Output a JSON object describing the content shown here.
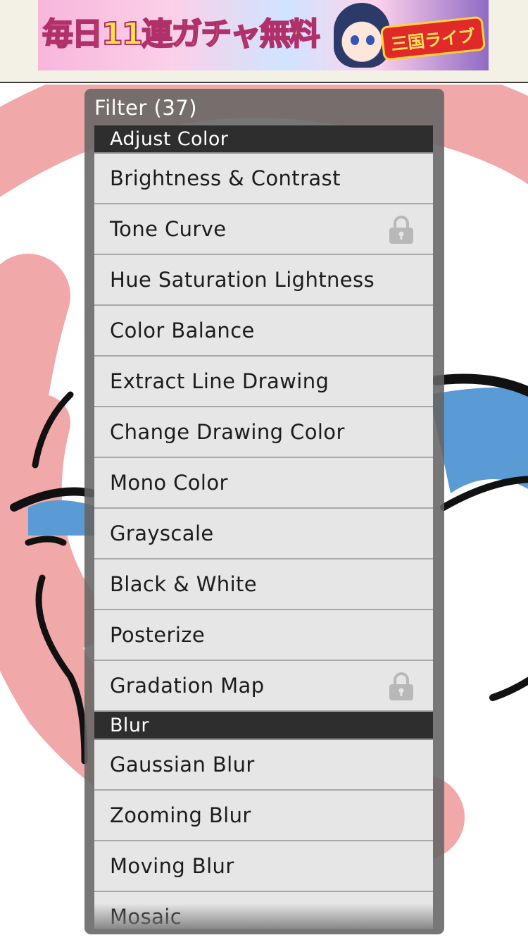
{
  "ad": {
    "text": "毎日11連ガチャ無料",
    "logo": "三国ライブ"
  },
  "panel": {
    "title": "Filter (37)"
  },
  "sections": [
    {
      "header": "Adjust Color",
      "items": [
        {
          "label": "Brightness & Contrast",
          "locked": false
        },
        {
          "label": "Tone Curve",
          "locked": true
        },
        {
          "label": "Hue Saturation Lightness",
          "locked": false
        },
        {
          "label": "Color Balance",
          "locked": false
        },
        {
          "label": "Extract Line Drawing",
          "locked": false
        },
        {
          "label": "Change Drawing Color",
          "locked": false
        },
        {
          "label": "Mono Color",
          "locked": false
        },
        {
          "label": "Grayscale",
          "locked": false
        },
        {
          "label": "Black & White",
          "locked": false
        },
        {
          "label": "Posterize",
          "locked": false
        },
        {
          "label": "Gradation Map",
          "locked": true
        }
      ]
    },
    {
      "header": "Blur",
      "items": [
        {
          "label": "Gaussian Blur",
          "locked": false
        },
        {
          "label": "Zooming Blur",
          "locked": false
        },
        {
          "label": "Moving Blur",
          "locked": false
        },
        {
          "label": "Mosaic",
          "locked": false
        }
      ]
    }
  ],
  "icons": {
    "lock": "lock-icon"
  },
  "colors": {
    "panel_bg": "#646464",
    "section_header_bg": "#2e2e2e",
    "item_bg": "#e6e6e6",
    "canvas_pink": "#f0a8a8",
    "canvas_blue": "#5b9bd5"
  }
}
